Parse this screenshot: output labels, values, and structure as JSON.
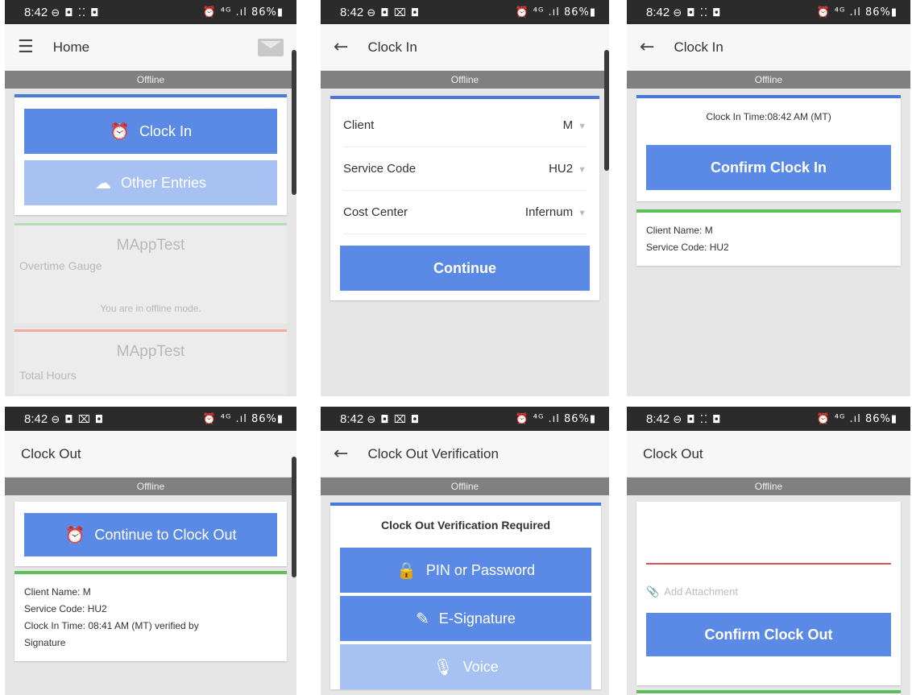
{
  "status_bar": {
    "time": "8:42",
    "left_icons_a": "⊖ ◘ ⁚⁚ ◘",
    "left_icons_b": "⊖ ◘ ⌧ ◘",
    "right_icons": "⏰ ⁴ᴳ .ıl 86%▮"
  },
  "common": {
    "offline": "Offline"
  },
  "screen1": {
    "title": "Home",
    "clock_in_label": "Clock In",
    "other_entries_label": "Other Entries",
    "card1": {
      "name": "MAppTest",
      "label": "Overtime Gauge",
      "message": "You are in offline mode."
    },
    "card2": {
      "name": "MAppTest",
      "label": "Total Hours"
    }
  },
  "screen2": {
    "title": "Clock In",
    "fields": [
      {
        "label": "Client",
        "value": "M"
      },
      {
        "label": "Service Code",
        "value": "HU2"
      },
      {
        "label": "Cost Center",
        "value": "Infernum"
      }
    ],
    "continue_label": "Continue"
  },
  "screen3": {
    "title": "Clock In",
    "clock_in_time": "Clock In Time:08:42 AM (MT)",
    "confirm_label": "Confirm Clock In",
    "client_name": "Client Name: M",
    "service_code": "Service Code: HU2"
  },
  "screen4": {
    "title": "Clock Out",
    "continue_label": "Continue to Clock Out",
    "client_name": "Client Name: M",
    "service_code": "Service Code: HU2",
    "clock_in_line1": "Clock In Time: 08:41 AM (MT) verified by",
    "clock_in_line2": "Signature"
  },
  "screen5": {
    "title": "Clock Out Verification",
    "heading": "Clock Out Verification Required",
    "pin_label": "PIN or Password",
    "esign_label": "E-Signature",
    "voice_label": "Voice"
  },
  "screen6": {
    "title": "Clock Out",
    "attachment_label": "Add Attachment",
    "confirm_label": "Confirm Clock Out"
  },
  "colors": {
    "primary_button": "#5b8ae6",
    "light_button": "#a7c1f2",
    "offline_bar": "#808080",
    "accent_green": "#5cbf5a",
    "accent_blue": "#4a78d8"
  }
}
